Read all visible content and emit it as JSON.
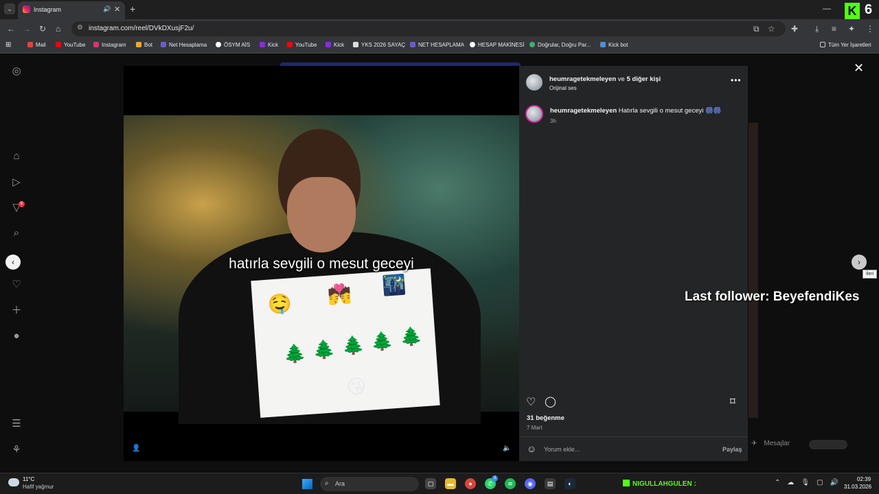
{
  "browser": {
    "tab": {
      "title": "Instagram",
      "audio_icon": "speaker-icon",
      "close_label": "✕"
    },
    "new_tab_label": "+",
    "minimize_label": "—",
    "kick_overlay": {
      "logo": "K",
      "number": "6"
    },
    "url": "instagram.com/reel/DVkDXusjF2u/",
    "bookmarks": [
      {
        "label": "Mail",
        "color": "#ea4335"
      },
      {
        "label": "YouTube",
        "color": "#ff0000"
      },
      {
        "label": "Instagram",
        "color": "#e1306c"
      },
      {
        "label": "Bot",
        "color": "#f5a623"
      },
      {
        "label": "Net Hesaplama",
        "color": "#6a5acd"
      },
      {
        "label": "ÖSYM AİS",
        "color": "#ffffff"
      },
      {
        "label": "Kick",
        "color": "#8a2be2"
      },
      {
        "label": "YouTube",
        "color": "#ff0000"
      },
      {
        "label": "Kick",
        "color": "#8a2be2"
      },
      {
        "label": "YKS 2026 SAYAÇ",
        "color": "#dddddd"
      },
      {
        "label": "NET HESAPLAMA",
        "color": "#6a5acd"
      },
      {
        "label": "HESAP MAKİNESİ",
        "color": "#ffffff"
      },
      {
        "label": "Doğrular, Doğru Par...",
        "color": "#3cb371"
      },
      {
        "label": "Kick bot",
        "color": "#4a90d9"
      }
    ],
    "all_bookmarks": "Tüm Yer İşaretleri"
  },
  "reel": {
    "subtitle": "hatırla sevgili o mesut geceyi",
    "emojis": [
      "🤤",
      "💏",
      "🌃",
      "🌲",
      "🌲",
      "🌲",
      "🌲",
      "🌲",
      "😘"
    ]
  },
  "panel": {
    "header_user": "heumragetekmeleyen",
    "header_and": " ve ",
    "header_others": "5 diğer kişi",
    "header_audio": "Orijinal ses",
    "more": "•••",
    "caption_user": "heumragetekmeleyen",
    "caption_text": " Hatırla sevgili o mesut geceyi 🎆🎆",
    "caption_time": "3h",
    "likes": "31 beğenme",
    "date": "7 Mart",
    "comment_placeholder": "Yorum ekle...",
    "share": "Paylaş"
  },
  "sidebar": {
    "notifications_badge": "6"
  },
  "next_tooltip": "İleri",
  "messages_label": "Mesajlar",
  "stream_overlay": "Last follower: BeyefendiKes",
  "taskbar": {
    "temp": "11°C",
    "condition": "Hafif yağmur",
    "search_label": "Ara",
    "whatsapp_badge": "3",
    "kick_ticker": "NIGULLAHGULEN :",
    "time": "02:39",
    "date": "31.03.2026"
  },
  "colors": {
    "kick_green": "#53fc18",
    "panel_bg": "#242526",
    "page_bg": "#0e0e0f"
  }
}
